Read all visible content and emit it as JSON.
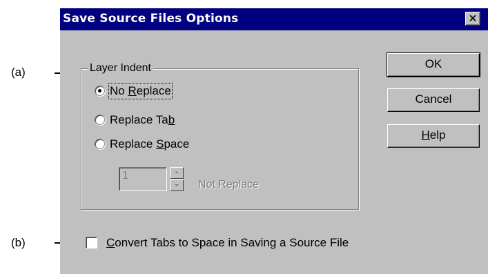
{
  "callouts": {
    "a": "(a)",
    "b": "(b)"
  },
  "dialog": {
    "title": "Save Source Files Options",
    "close_glyph": "×",
    "layer_indent": {
      "legend": "Layer Indent",
      "options": [
        {
          "pre": "No ",
          "mnemonic": "R",
          "post": "eplace",
          "selected": true
        },
        {
          "pre": "Replace Ta",
          "mnemonic": "b",
          "post": "",
          "selected": false
        },
        {
          "pre": "Replace ",
          "mnemonic": "S",
          "post": "pace",
          "selected": false
        }
      ],
      "spin_value": "1",
      "spin_label": "Not Replace"
    },
    "buttons": {
      "ok": "OK",
      "cancel": "Cancel",
      "help_mnemonic": "H",
      "help_rest": "elp"
    },
    "convert_tabs": {
      "mnemonic": "C",
      "rest": "onvert Tabs to Space in Saving a Source File",
      "checked": false
    }
  }
}
